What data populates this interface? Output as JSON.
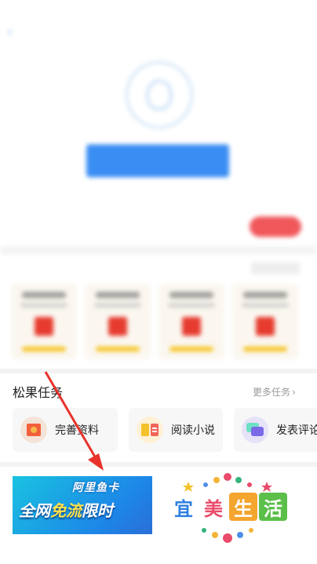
{
  "status_bar": {
    "carrier": "",
    "time": "",
    "battery": ""
  },
  "nav": {
    "back_label": "",
    "title": ""
  },
  "profile": {
    "bind_button_label": "",
    "hint": "",
    "action_label": ""
  },
  "center": {
    "title": "",
    "more": ""
  },
  "tasks_section": {
    "title": "松果任务",
    "more_label": "更多任务",
    "items": [
      {
        "label": "完善资料",
        "icon": "profile-card-icon"
      },
      {
        "label": "阅读小说",
        "icon": "book-icon"
      },
      {
        "label": "发表评论",
        "icon": "comment-bubble-icon"
      }
    ]
  },
  "banners": {
    "left": {
      "top_text": "阿里鱼卡",
      "main_plain": "全网",
      "main_highlight": "免流",
      "main_tail": "限时"
    },
    "right": {
      "chars": [
        "宜",
        "美",
        "生",
        "活"
      ]
    }
  },
  "colors": {
    "accent_blue": "#3a8ef3",
    "accent_red": "#f0575b",
    "arrow_red": "#e8322b"
  }
}
